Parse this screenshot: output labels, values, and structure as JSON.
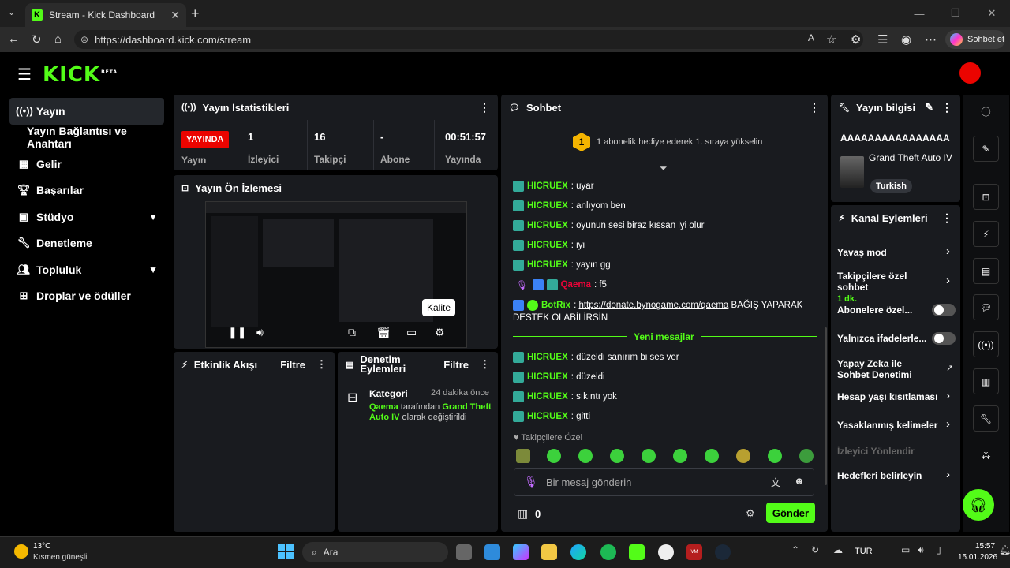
{
  "browser": {
    "tab_title": "Stream - Kick Dashboard",
    "url": "https://dashboard.kick.com/stream",
    "copilot_label": "Sohbet et"
  },
  "app": {
    "logo": "KICK",
    "logo_badge": "BETA"
  },
  "sidebar": {
    "items": [
      {
        "label": "Yayın",
        "icon": "broadcast-icon"
      },
      {
        "label": "Yayın Bağlantısı ve Anahtarı",
        "icon": ""
      },
      {
        "label": "Gelir",
        "icon": "revenue-icon"
      },
      {
        "label": "Başarılar",
        "icon": "trophy-icon"
      },
      {
        "label": "Stüdyo",
        "icon": "studio-icon"
      },
      {
        "label": "Denetleme",
        "icon": "wrench-icon"
      },
      {
        "label": "Topluluk",
        "icon": "community-icon"
      },
      {
        "label": "Droplar ve ödüller",
        "icon": "drops-icon"
      }
    ]
  },
  "stats": {
    "title": "Yayın İstatistikleri",
    "live_label": "YAYINDA",
    "cols": [
      {
        "value": "",
        "label": "Yayın"
      },
      {
        "value": "1",
        "label": "İzleyici"
      },
      {
        "value": "16",
        "label": "Takipçi"
      },
      {
        "value": "-",
        "label": "Abone Sayısı"
      },
      {
        "value": "00:51:57",
        "label": "Yayında Olduğu"
      }
    ]
  },
  "preview": {
    "title": "Yayın Ön İzlemesi",
    "tooltip": "Kalite"
  },
  "activity": {
    "title": "Etkinlik Akışı",
    "filter": "Filtre"
  },
  "mod_actions": {
    "title": "Denetim Eylemleri",
    "filter": "Filtre",
    "entry_title": "Kategori",
    "entry_time": "24 dakika önce",
    "entry_user": "Qaema",
    "entry_mid": " tarafından ",
    "entry_game": "Grand Theft Auto IV",
    "entry_end": " olarak değiştirildi"
  },
  "chat": {
    "title": "Sohbet",
    "gift_rank": "1",
    "gift_text": "1 abonelik hediye ederek 1. sıraya yükselin",
    "messages": [
      {
        "user": "HICRUEX",
        "text": "uyar"
      },
      {
        "user": "HICRUEX",
        "text": "anlıyom ben"
      },
      {
        "user": "HICRUEX",
        "text": "oyunun sesi biraz kıssan iyi olur"
      },
      {
        "user": "HICRUEX",
        "text": "iyi"
      },
      {
        "user": "HICRUEX",
        "text": "yayın gg"
      },
      {
        "user": "Qaema",
        "text": "f5"
      }
    ],
    "bot_user": "BotRix",
    "bot_link": "https://donate.bynogame.com/qaema",
    "bot_text": " BAĞIŞ YAPARAK",
    "bot_text2": "DESTEK OLABİLİRSİN",
    "new_messages": "Yeni mesajlar",
    "new": [
      {
        "user": "HICRUEX",
        "text": "düzeldi sanırım bi ses ver"
      },
      {
        "user": "HICRUEX",
        "text": "düzeldi"
      },
      {
        "user": "HICRUEX",
        "text": "sıkıntı yok"
      },
      {
        "user": "HICRUEX",
        "text": "gitti"
      }
    ],
    "followers_only": "Takipçilere Özel",
    "input_placeholder": "Bir mesaj gönderin",
    "points": "0",
    "send": "Gönder"
  },
  "stream_info": {
    "title": "Yayın bilgisi",
    "stream_title": "AAAAAAAAAAAAAAAA",
    "game": "Grand Theft Auto IV",
    "language": "Turkish"
  },
  "channel_actions": {
    "title": "Kanal Eylemleri",
    "items": [
      {
        "label": "Yavaş mod"
      },
      {
        "label": "Takipçilere özel sohbet",
        "sub": "1 dk."
      },
      {
        "label": "Abonelere özel..."
      },
      {
        "label": "Yalnızca ifadelerle..."
      },
      {
        "label": "Yapay Zeka ile Sohbet Denetimi"
      },
      {
        "label": "Hesap yaşı kısıtlaması"
      },
      {
        "label": "Yasaklanmış kelimeler"
      },
      {
        "label": "İzleyici Yönlendir"
      },
      {
        "label": "Hedefleri belirleyin"
      }
    ]
  },
  "taskbar": {
    "weather_temp": "13°C",
    "weather_text": "Kısmen güneşli",
    "search": "Ara",
    "lang": "TUR",
    "time": "15:57",
    "date": "15.01.2026"
  },
  "colors": {
    "accent": "#53fc18",
    "live": "#eb0400",
    "panel": "#191b1f"
  }
}
